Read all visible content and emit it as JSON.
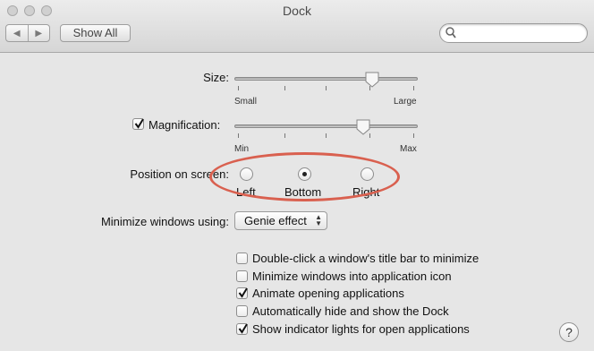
{
  "window": {
    "title": "Dock"
  },
  "toolbar": {
    "back_icon": "back-arrow-icon",
    "forward_icon": "forward-arrow-icon",
    "show_all_label": "Show All",
    "search_placeholder": "",
    "search_value": ""
  },
  "size": {
    "label": "Size:",
    "min_label": "Small",
    "max_label": "Large",
    "value": 0.75
  },
  "magnification": {
    "label": "Magnification:",
    "checked": true,
    "min_label": "Min",
    "max_label": "Max",
    "value": 0.7
  },
  "position": {
    "label": "Position on screen:",
    "options": [
      {
        "label": "Left",
        "selected": false
      },
      {
        "label": "Bottom",
        "selected": true
      },
      {
        "label": "Right",
        "selected": false
      }
    ]
  },
  "minimize": {
    "label": "Minimize windows using:",
    "selected": "Genie effect"
  },
  "checkboxes": [
    {
      "label": "Double-click a window's title bar to minimize",
      "checked": false
    },
    {
      "label": "Minimize windows into application icon",
      "checked": false
    },
    {
      "label": "Animate opening applications",
      "checked": true
    },
    {
      "label": "Automatically hide and show the Dock",
      "checked": false
    },
    {
      "label": "Show indicator lights for open applications",
      "checked": true
    }
  ],
  "help": {
    "label": "?"
  },
  "colors": {
    "annotation": "#d9604f"
  }
}
